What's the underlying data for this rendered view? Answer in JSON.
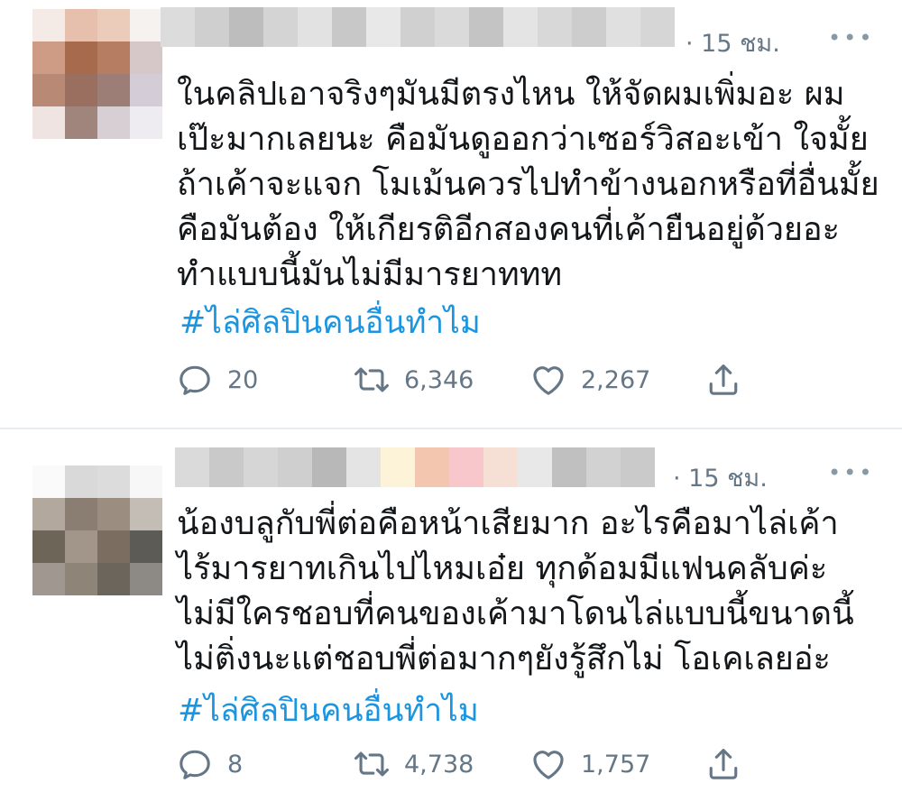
{
  "tweets": [
    {
      "time": "· 15 ชม.",
      "more": "•••",
      "lines": [
        "ในคลิปเอาจริงๆมันมีตรงไหน ให้จัดผมเพิ่มอะ ผม",
        "เป๊ะมากเลยนะ คือมันดูออกว่าเซอร์วิสอะเข้า ใจมั้ย",
        "ถ้าเค้าจะแจก โมเม้นควรไปทำข้างนอกหรือที่อื่นมั้ย",
        "คือมันต้อง ให้เกียรติอีกสองคนที่เค้ายืนอยู่ด้วยอะ",
        "ทำแบบนี้มันไม่มีมารยาททท"
      ],
      "hashtag": "#ไล่ศิลปินคนอื่นทำไม",
      "replies": "20",
      "retweets": "6,346",
      "likes": "2,267",
      "icons": {
        "reply": "reply-icon",
        "retweet": "retweet-icon",
        "like": "heart-icon",
        "share": "share-icon"
      }
    },
    {
      "time": "· 15 ชม.",
      "more": "•••",
      "lines": [
        "น้องบลูกับพี่ต่อคือหน้าเสียมาก อะไรคือมาไล่เค้า",
        "ไร้มารยาทเกินไปไหมเอ๋ย ทุกด้อมมีแฟนคลับค่ะ",
        "ไม่มีใครชอบที่คนของเค้ามาโดนไล่แบบนี้ขนาดนี้",
        "ไม่ติ่งนะแต่ชอบพี่ต่อมากๆยังรู้สึกไม่ โอเคเลยอ่ะ"
      ],
      "hashtag": "#ไล่ศิลปินคนอื่นทำไม",
      "replies": "8",
      "retweets": "4,738",
      "likes": "1,757",
      "icons": {
        "reply": "reply-icon",
        "retweet": "retweet-icon",
        "like": "heart-icon",
        "share": "share-icon"
      }
    }
  ],
  "colors": {
    "hashtag": "#1b95e0",
    "secondary_text": "#657786",
    "body_text": "#14171a",
    "divider": "#e6ecf0",
    "avatar1": [
      "#f4ebe6",
      "#e6c0ad",
      "#ebcbb9",
      "#f6f2f0",
      "#ce9c84",
      "#a86a4c",
      "#b67d63",
      "#d6c8c9",
      "#b88a76",
      "#9a6f5f",
      "#9c7e77",
      "#d4ccd6",
      "#f0e4e2",
      "#9f857b",
      "#d7cfd4",
      "#eeecf1"
    ],
    "avatar2": [
      "#fafafa",
      "#d9d9d9",
      "#dcdcdc",
      "#f7f7f7",
      "#b2a89d",
      "#8a7e72",
      "#9b8d80",
      "#c3bdb6",
      "#6d6558",
      "#a2958a",
      "#7b6e60",
      "#5d5b55",
      "#a09890",
      "#8e8478",
      "#6c655c",
      "#8d8a86"
    ],
    "name1": [
      "#dcdcdc",
      "#cfcfcf",
      "#bdbdbd",
      "#d4d4d4",
      "#e2e2e2",
      "#c8c8c8",
      "#e8e8e8",
      "#d0d0d0",
      "#dadada",
      "#c4c4c4",
      "#e4e4e4",
      "#d8d8d8",
      "#cdcdcd",
      "#e0e0e0",
      "#d6d6d6"
    ],
    "name2": [
      "#dadada",
      "#c9c9c9",
      "#d6d6d6",
      "#cfcfcf",
      "#b8b8b8",
      "#e4e4e4",
      "#fdf3d8",
      "#f3c6b0",
      "#f7c7cc",
      "#f6e0d5",
      "#e8e8e8",
      "#c0c0c0",
      "#d2d2d2",
      "#cacaca"
    ]
  }
}
